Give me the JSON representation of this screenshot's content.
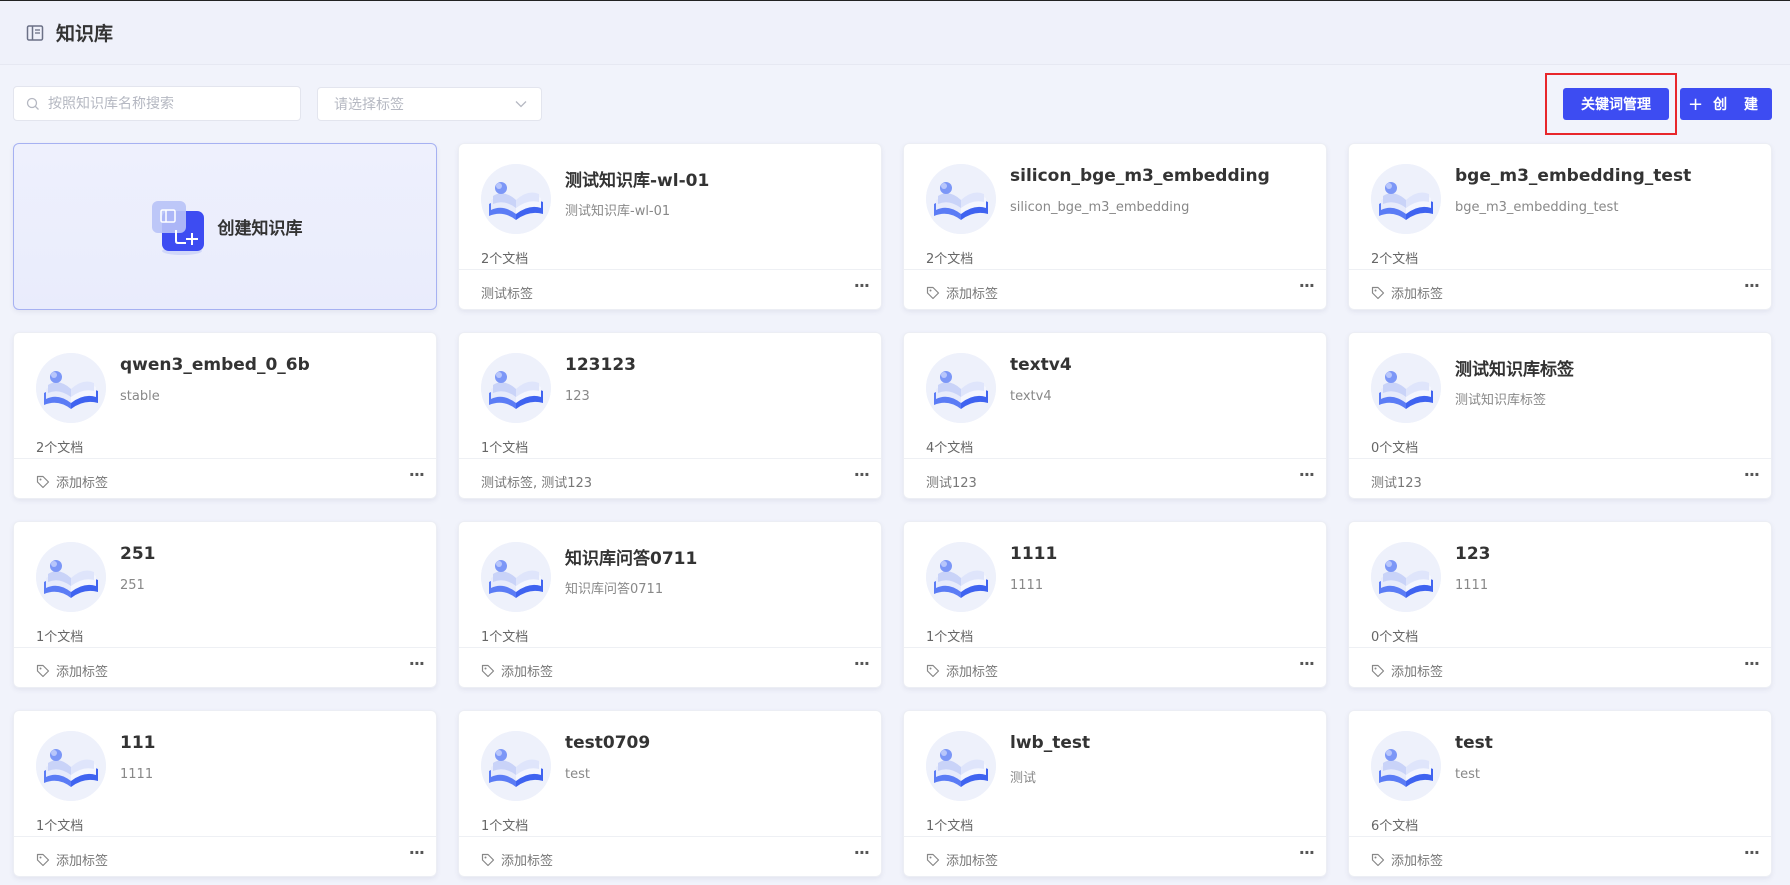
{
  "header": {
    "title": "知识库"
  },
  "toolbar": {
    "search_placeholder": "按照知识库名称搜索",
    "tag_placeholder": "请选择标签",
    "keyword_button": "关键词管理",
    "create_button": "创 建"
  },
  "create_card": {
    "label": "创建知识库"
  },
  "cards": [
    {
      "name": "测试知识库-wl-01",
      "desc": "测试知识库-wl-01",
      "docs": "2个文档",
      "tags": "测试标签",
      "has_tags": true
    },
    {
      "name": "silicon_bge_m3_embedding",
      "desc": "silicon_bge_m3_embedding",
      "docs": "2个文档",
      "tags": "添加标签",
      "has_tags": false
    },
    {
      "name": "bge_m3_embedding_test",
      "desc": "bge_m3_embedding_test",
      "docs": "2个文档",
      "tags": "添加标签",
      "has_tags": false
    },
    {
      "name": "qwen3_embed_0_6b",
      "desc": "stable",
      "docs": "2个文档",
      "tags": "添加标签",
      "has_tags": false
    },
    {
      "name": "123123",
      "desc": "123",
      "docs": "1个文档",
      "tags": "测试标签, 测试123",
      "has_tags": true
    },
    {
      "name": "textv4",
      "desc": "textv4",
      "docs": "4个文档",
      "tags": "测试123",
      "has_tags": true
    },
    {
      "name": "测试知识库标签",
      "desc": "测试知识库标签",
      "docs": "0个文档",
      "tags": "测试123",
      "has_tags": true
    },
    {
      "name": "251",
      "desc": "251",
      "docs": "1个文档",
      "tags": "添加标签",
      "has_tags": false
    },
    {
      "name": "知识库问答0711",
      "desc": "知识库问答0711",
      "docs": "1个文档",
      "tags": "添加标签",
      "has_tags": false
    },
    {
      "name": "1111",
      "desc": "1111",
      "docs": "1个文档",
      "tags": "添加标签",
      "has_tags": false
    },
    {
      "name": "123",
      "desc": "1111",
      "docs": "0个文档",
      "tags": "添加标签",
      "has_tags": false
    },
    {
      "name": "111",
      "desc": "1111",
      "docs": "1个文档",
      "tags": "添加标签",
      "has_tags": false
    },
    {
      "name": "test0709",
      "desc": "test",
      "docs": "1个文档",
      "tags": "添加标签",
      "has_tags": false
    },
    {
      "name": "lwb_test",
      "desc": "测试",
      "docs": "1个文档",
      "tags": "添加标签",
      "has_tags": false
    },
    {
      "name": "test",
      "desc": "test",
      "docs": "6个文档",
      "tags": "添加标签",
      "has_tags": false
    }
  ],
  "colors": {
    "primary": "#3d4cf2",
    "highlight": "#e8262b"
  },
  "icons": {
    "header": "book-icon",
    "search": "search-icon",
    "dropdown": "chevron-down-icon",
    "tag": "tag-icon",
    "more": "more-icon"
  }
}
